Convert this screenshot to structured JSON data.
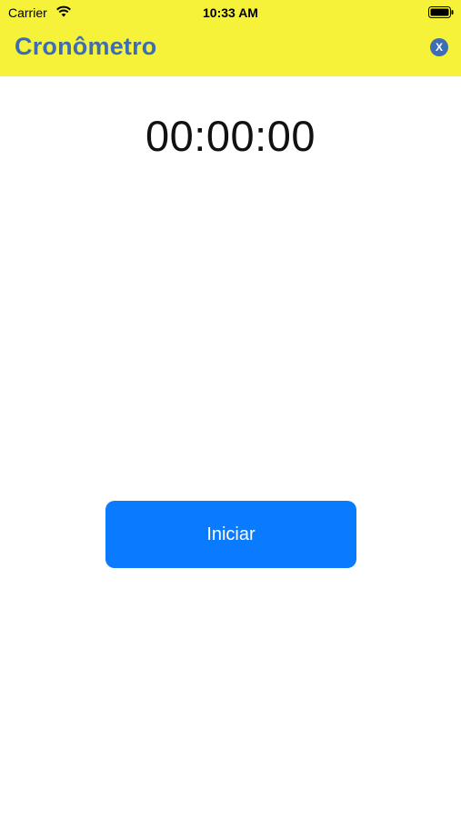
{
  "status_bar": {
    "carrier": "Carrier",
    "time": "10:33 AM",
    "wifi_icon": "wifi-icon",
    "battery_icon": "battery-icon"
  },
  "header": {
    "title": "Cronômetro",
    "close_label": "X",
    "background_color": "#f6f23a",
    "title_color": "#3d6eb3"
  },
  "timer": {
    "display": "00:00:00"
  },
  "actions": {
    "start_label": "Iniciar",
    "button_color": "#0a7bff"
  }
}
